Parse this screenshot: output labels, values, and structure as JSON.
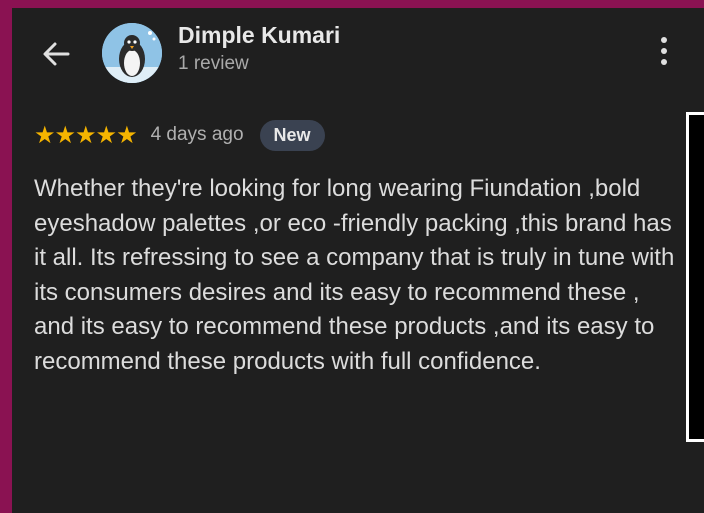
{
  "header": {
    "name": "Dimple Kumari",
    "review_count": "1 review"
  },
  "rating": {
    "stars": "★★★★★",
    "value": 5,
    "max": 5,
    "age": "4 days ago",
    "badge": "New"
  },
  "review": {
    "text": "Whether they're looking for long wearing Fiundation ,bold eyeshadow palettes ,or eco -friendly packing ,this brand has it all. Its refressing to see a company that is truly in tune with its consumers desires and its easy to recommend these , and its easy to recommend these products ,and its easy to recommend these products with full confidence."
  },
  "icons": {
    "back": "arrow-back-icon",
    "more": "more-vert-icon",
    "avatar": "penguin-avatar"
  },
  "colors": {
    "background": "#1f1f1f",
    "star": "#f5b400",
    "badge_bg": "#3a4251",
    "frame": "#8a1252"
  }
}
